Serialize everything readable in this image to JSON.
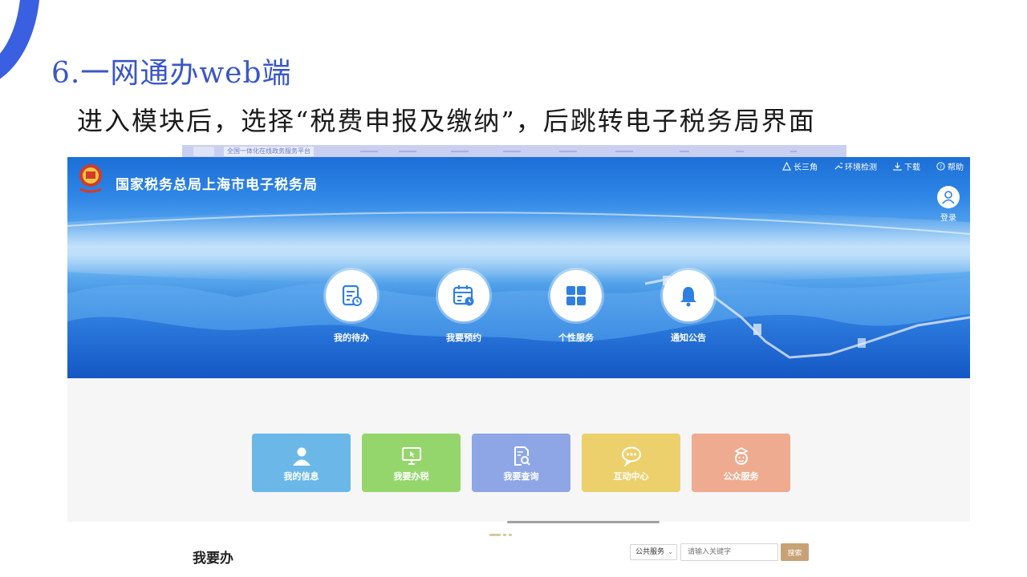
{
  "slide": {
    "title": "6.一网通办web端",
    "subtitle": "进入模块后，选择“税费申报及缴纳”，后跳转电子税务局界面"
  },
  "back_strip": {
    "tag": "全国一体化在线政务服务平台"
  },
  "header": {
    "site_name": "国家税务总局上海市电子税务局",
    "links": [
      {
        "icon": "triangle-icon",
        "label": "长三角"
      },
      {
        "icon": "wrench-icon",
        "label": "环境检测"
      },
      {
        "icon": "download-icon",
        "label": "下载"
      },
      {
        "icon": "help-icon",
        "label": "帮助"
      }
    ],
    "login_label": "登录"
  },
  "quick_entries": [
    {
      "icon": "todo-list-icon",
      "label": "我的待办"
    },
    {
      "icon": "calendar-clock-icon",
      "label": "我要预约"
    },
    {
      "icon": "grid-icon",
      "label": "个性服务"
    },
    {
      "icon": "bell-icon",
      "label": "通知公告"
    }
  ],
  "tiles": [
    {
      "icon": "user-icon",
      "label": "我的信息",
      "color": "#6bb8e8"
    },
    {
      "icon": "monitor-icon",
      "label": "我要办税",
      "color": "#95d66c"
    },
    {
      "icon": "search-doc-icon",
      "label": "我要查询",
      "color": "#8ea6e6"
    },
    {
      "icon": "chat-icon",
      "label": "互动中心",
      "color": "#ecd06c"
    },
    {
      "icon": "public-service-icon",
      "label": "公众服务",
      "color": "#efab8f"
    }
  ],
  "section": {
    "title": "我要办",
    "scope_selected": "公共服务",
    "search_placeholder": "请输入关键字",
    "search_button": "搜索"
  },
  "colors": {
    "accent_title": "#3a56c8",
    "arc": "#3a5fe0",
    "banner_top": "#1c6fd6",
    "search_button": "#c7a274"
  }
}
